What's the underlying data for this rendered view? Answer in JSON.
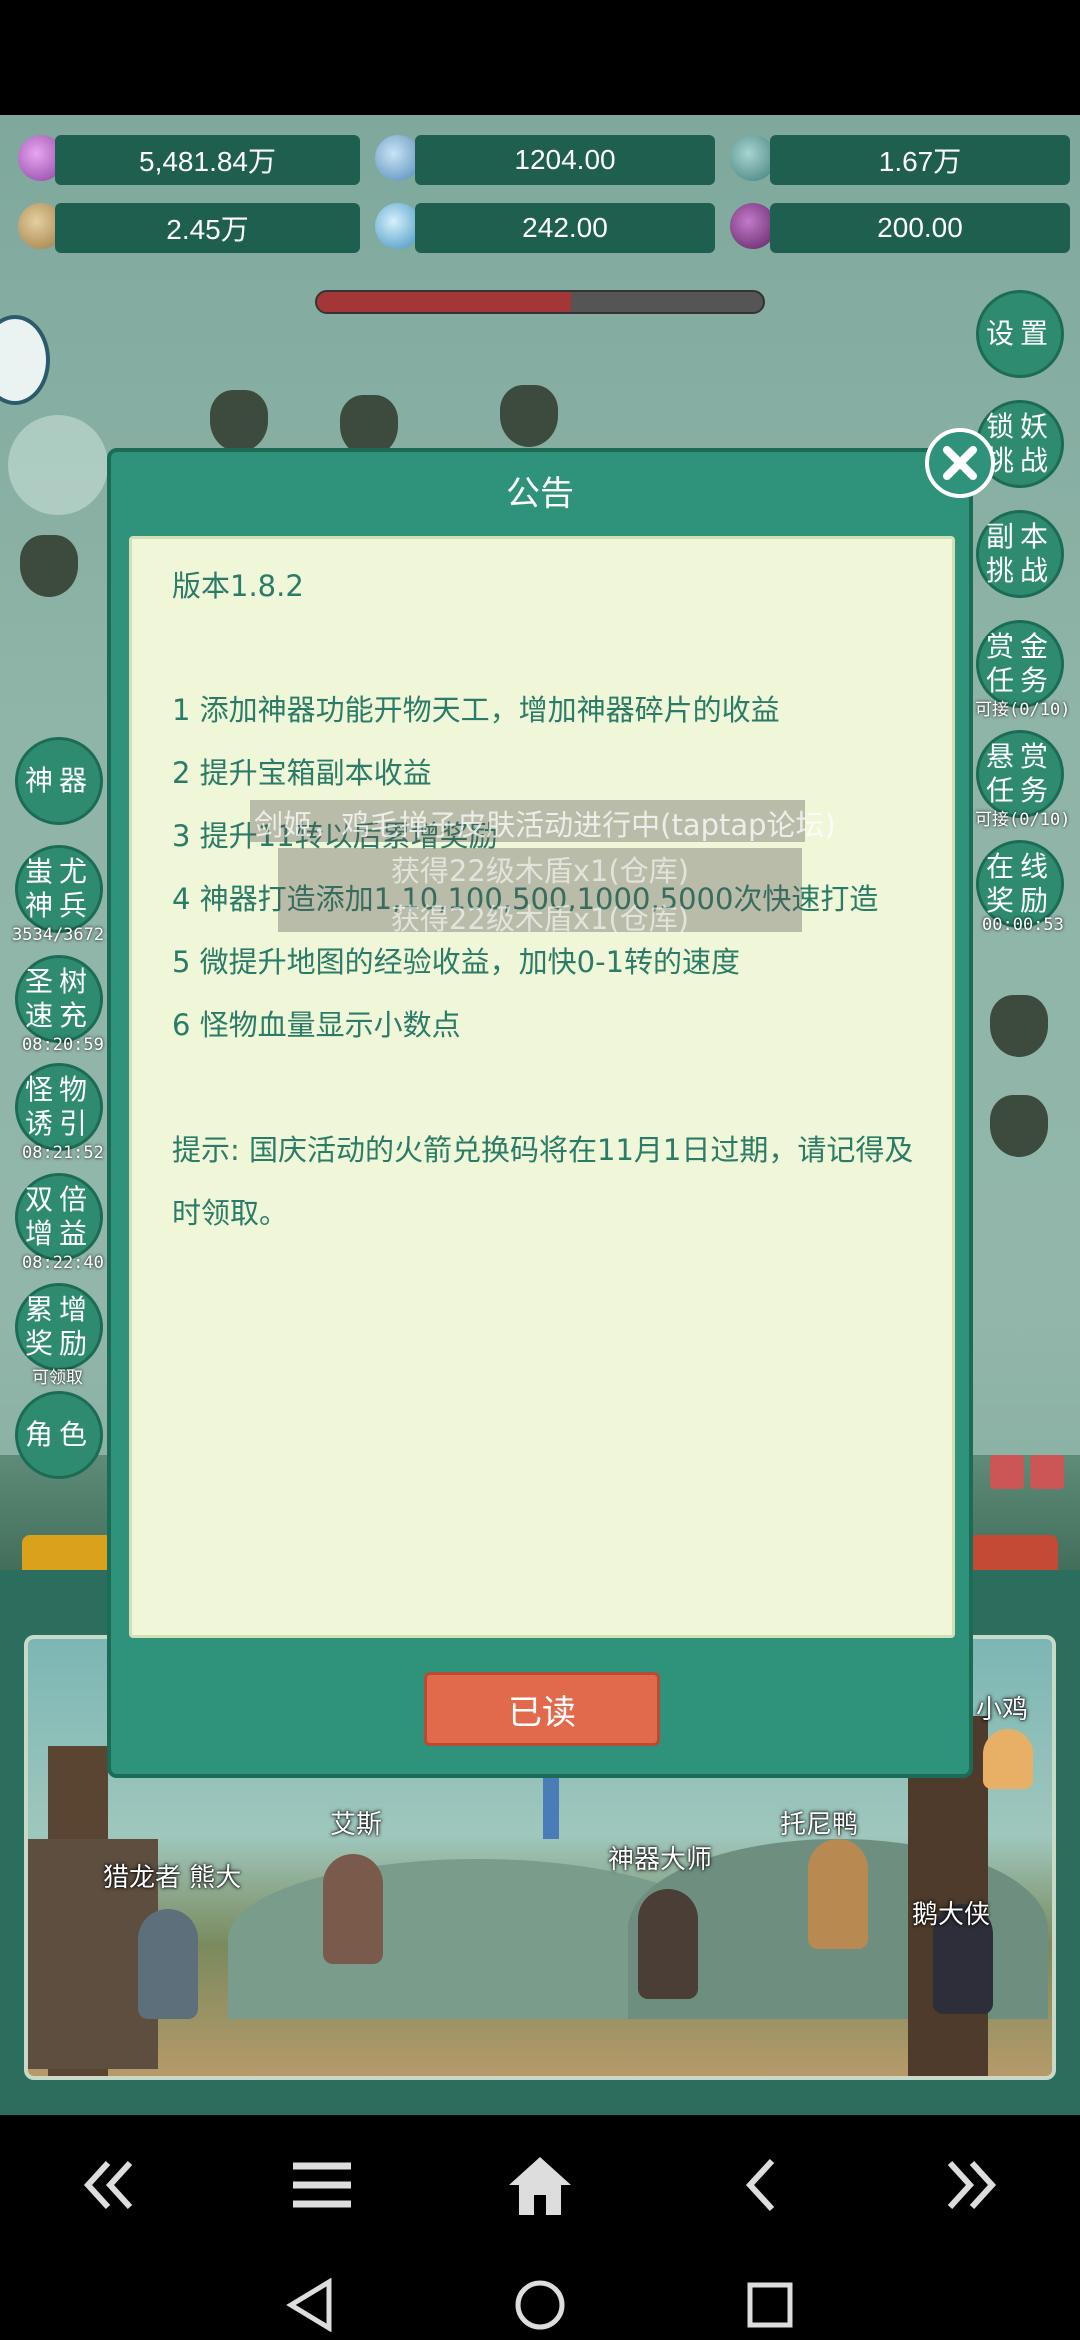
{
  "resources": {
    "gem_value": "5,481.84万",
    "orb_value": "1204.00",
    "ore_value": "1.67万",
    "wood_value": "2.45万",
    "crystal_value": "242.00",
    "potion_value": "200.00"
  },
  "side_left": [
    {
      "label": "神器"
    },
    {
      "label": "蚩尤神兵",
      "timer": "3534/3672"
    },
    {
      "label": "圣树速充",
      "timer": "08:20:59"
    },
    {
      "label": "怪物诱引",
      "timer": "08:21:52"
    },
    {
      "label": "双倍增益",
      "timer": "08:22:40"
    },
    {
      "label": "累增奖励",
      "timer": "可领取"
    },
    {
      "label": "角色"
    }
  ],
  "side_right": [
    {
      "label": "设置"
    },
    {
      "label": "锁妖挑战"
    },
    {
      "label": "副本挑战"
    },
    {
      "label": "赏金任务",
      "timer": "可接(0/10)"
    },
    {
      "label": "悬赏任务",
      "timer": "可接(0/10)"
    },
    {
      "label": "在线奖励",
      "timer": "00:00:53"
    }
  ],
  "dialog": {
    "title": "公告",
    "version": "版本1.8.2",
    "items": [
      "1 添加神器功能开物天工，增加神器碎片的收益",
      "2 提升宝箱副本收益",
      "3 提升11转以后累增奖励",
      "4 神器打造添加1,10,100,500,1000,5000次快速打造",
      "5 微提升地图的经验收益，加快0-1转的速度",
      "6 怪物血量显示小数点"
    ],
    "tip": "提示: 国庆活动的火箭兑换码将在11月1日过期，请记得及时领取。",
    "read_button": "已读"
  },
  "toasts": [
    "剑姬，鸡毛掸子皮肤活动进行中(taptap论坛)",
    "获得22级木盾x1(仓库)",
    "获得22级木盾x1(仓库)"
  ],
  "characters": [
    "猎龙者 熊大",
    "艾斯",
    "神器大师",
    "托尼鸭",
    "小鸡",
    "鹅大侠"
  ],
  "hp_fraction": 0.57
}
